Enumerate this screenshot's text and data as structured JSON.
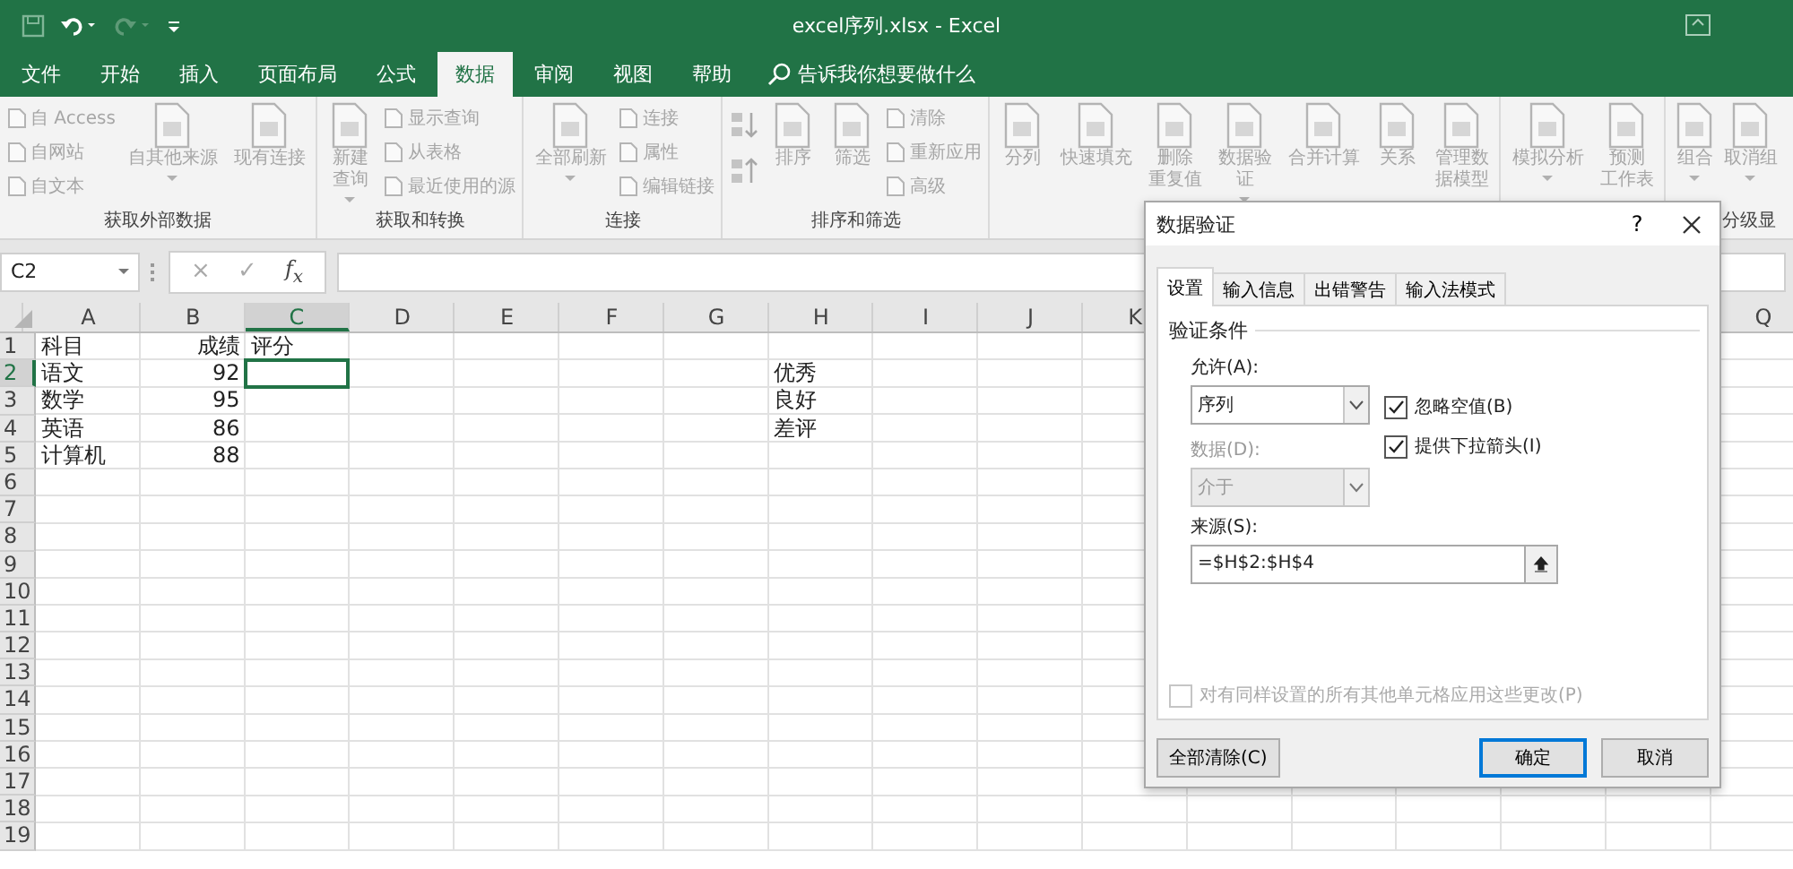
{
  "window": {
    "title": "excel序列.xlsx  -  Excel"
  },
  "tabs": [
    {
      "label": "文件",
      "selected": false
    },
    {
      "label": "开始",
      "selected": false
    },
    {
      "label": "插入",
      "selected": false
    },
    {
      "label": "页面布局",
      "selected": false
    },
    {
      "label": "公式",
      "selected": false
    },
    {
      "label": "数据",
      "selected": true
    },
    {
      "label": "审阅",
      "selected": false
    },
    {
      "label": "视图",
      "selected": false
    },
    {
      "label": "帮助",
      "selected": false
    }
  ],
  "search": {
    "placeholder": "告诉我你想要做什么"
  },
  "ribbon": [
    {
      "label": "获取外部数据",
      "columns": [
        {
          "kind": "stack",
          "items": [
            "自 Access",
            "自网站",
            "自文本"
          ]
        },
        {
          "kind": "large",
          "lines": [
            "自其他来源"
          ],
          "dropdown": true
        },
        {
          "kind": "large",
          "lines": [
            "现有连接"
          ],
          "dropdown": false
        }
      ]
    },
    {
      "label": "获取和转换",
      "columns": [
        {
          "kind": "large",
          "lines": [
            "新建",
            "查询"
          ],
          "dropdown": true
        },
        {
          "kind": "stack",
          "items": [
            "显示查询",
            "从表格",
            "最近使用的源"
          ]
        }
      ]
    },
    {
      "label": "连接",
      "columns": [
        {
          "kind": "large",
          "lines": [
            "全部刷新"
          ],
          "dropdown": true
        },
        {
          "kind": "stack",
          "items": [
            "连接",
            "属性",
            "编辑链接"
          ]
        }
      ]
    },
    {
      "label": "排序和筛选",
      "columns": [
        {
          "kind": "sort"
        },
        {
          "kind": "large",
          "lines": [
            "排序"
          ],
          "dropdown": false
        },
        {
          "kind": "large",
          "lines": [
            "筛选"
          ],
          "dropdown": false
        },
        {
          "kind": "stack",
          "items": [
            "清除",
            "重新应用",
            "高级"
          ]
        }
      ]
    },
    {
      "columns": [
        {
          "kind": "large",
          "lines": [
            "分列"
          ],
          "dropdown": false
        },
        {
          "kind": "large",
          "lines": [
            "快速填充"
          ],
          "dropdown": false
        },
        {
          "kind": "large",
          "lines": [
            "删除",
            "重复值"
          ],
          "dropdown": false
        },
        {
          "kind": "large",
          "lines": [
            "数据验",
            "证"
          ],
          "dropdown": true
        },
        {
          "kind": "large",
          "lines": [
            "合并计算"
          ],
          "dropdown": false
        },
        {
          "kind": "large",
          "lines": [
            "关系"
          ],
          "dropdown": false
        },
        {
          "kind": "large",
          "lines": [
            "管理数",
            "据模型"
          ],
          "dropdown": false
        }
      ]
    },
    {
      "columns": [
        {
          "kind": "large",
          "lines": [
            "模拟分析"
          ],
          "dropdown": true
        },
        {
          "kind": "large",
          "lines": [
            "预测",
            "工作表"
          ],
          "dropdown": false
        }
      ]
    },
    {
      "label": "分级显",
      "columns": [
        {
          "kind": "large",
          "lines": [
            "组合"
          ],
          "dropdown": true
        },
        {
          "kind": "large",
          "lines": [
            "取消组"
          ],
          "dropdown": true
        }
      ]
    }
  ],
  "formula_bar": {
    "name_box": "C2",
    "buttons": [
      "×",
      "✓"
    ],
    "function_label": "f$_{x}$"
  },
  "sheet": {
    "columns": [
      {
        "label": "A",
        "selected": false
      },
      {
        "label": "B",
        "selected": false
      },
      {
        "label": "C",
        "selected": true
      },
      {
        "label": "D",
        "selected": false
      },
      {
        "label": "E",
        "selected": false
      },
      {
        "label": "F",
        "selected": false
      },
      {
        "label": "G",
        "selected": false
      },
      {
        "label": "H",
        "selected": false
      },
      {
        "label": "I",
        "selected": false
      },
      {
        "label": "J",
        "selected": false
      },
      {
        "label": "K",
        "selected": false
      },
      {
        "label": "Q",
        "selected": false
      }
    ],
    "rows": [
      {
        "number": "1",
        "selected": false,
        "column_a": "科目",
        "column_b": "成绩",
        "column_c": "评分"
      },
      {
        "number": "2",
        "selected": true,
        "column_a": "语文",
        "column_b": "92",
        "column_h": "优秀"
      },
      {
        "number": "3",
        "selected": false,
        "column_a": "数学",
        "column_b": "95",
        "column_h": "良好"
      },
      {
        "number": "4",
        "selected": false,
        "column_a": "英语",
        "column_b": "86",
        "column_h": "差评"
      },
      {
        "number": "5",
        "selected": false,
        "column_a": "计算机",
        "column_b": "88"
      },
      {
        "number": "6",
        "selected": false
      },
      {
        "number": "7",
        "selected": false
      },
      {
        "number": "8",
        "selected": false
      },
      {
        "number": "9",
        "selected": false
      },
      {
        "number": "10",
        "selected": false
      },
      {
        "number": "11",
        "selected": false
      },
      {
        "number": "12",
        "selected": false
      },
      {
        "number": "13",
        "selected": false
      },
      {
        "number": "14",
        "selected": false
      },
      {
        "number": "15",
        "selected": false
      },
      {
        "number": "16",
        "selected": false
      },
      {
        "number": "17",
        "selected": false
      },
      {
        "number": "18",
        "selected": false
      },
      {
        "number": "19",
        "selected": false
      }
    ]
  },
  "dialog": {
    "title": "数据验证",
    "help": "?",
    "tabs": [
      {
        "label": "设置",
        "selected": true
      },
      {
        "label": "输入信息",
        "selected": false
      },
      {
        "label": "出错警告",
        "selected": false
      },
      {
        "label": "输入法模式",
        "selected": false
      }
    ],
    "group_label": "验证条件",
    "allow": {
      "label": "允许(A):",
      "value": "序列"
    },
    "data": {
      "label": "数据(D):",
      "value": "介于",
      "disabled": true
    },
    "checkboxes": [
      {
        "label": "忽略空值(B)",
        "checked": true
      },
      {
        "label": "提供下拉箭头(I)",
        "checked": true
      }
    ],
    "source": {
      "label": "来源(S):",
      "value": "=$H$2:$H$4"
    },
    "apply_all": {
      "label": "对有同样设置的所有其他单元格应用这些更改(P)",
      "checked": false
    },
    "buttons": [
      {
        "label": "全部清除(C)",
        "default": false
      },
      {
        "label": "确定",
        "default": true
      },
      {
        "label": "取消",
        "default": false
      }
    ]
  }
}
